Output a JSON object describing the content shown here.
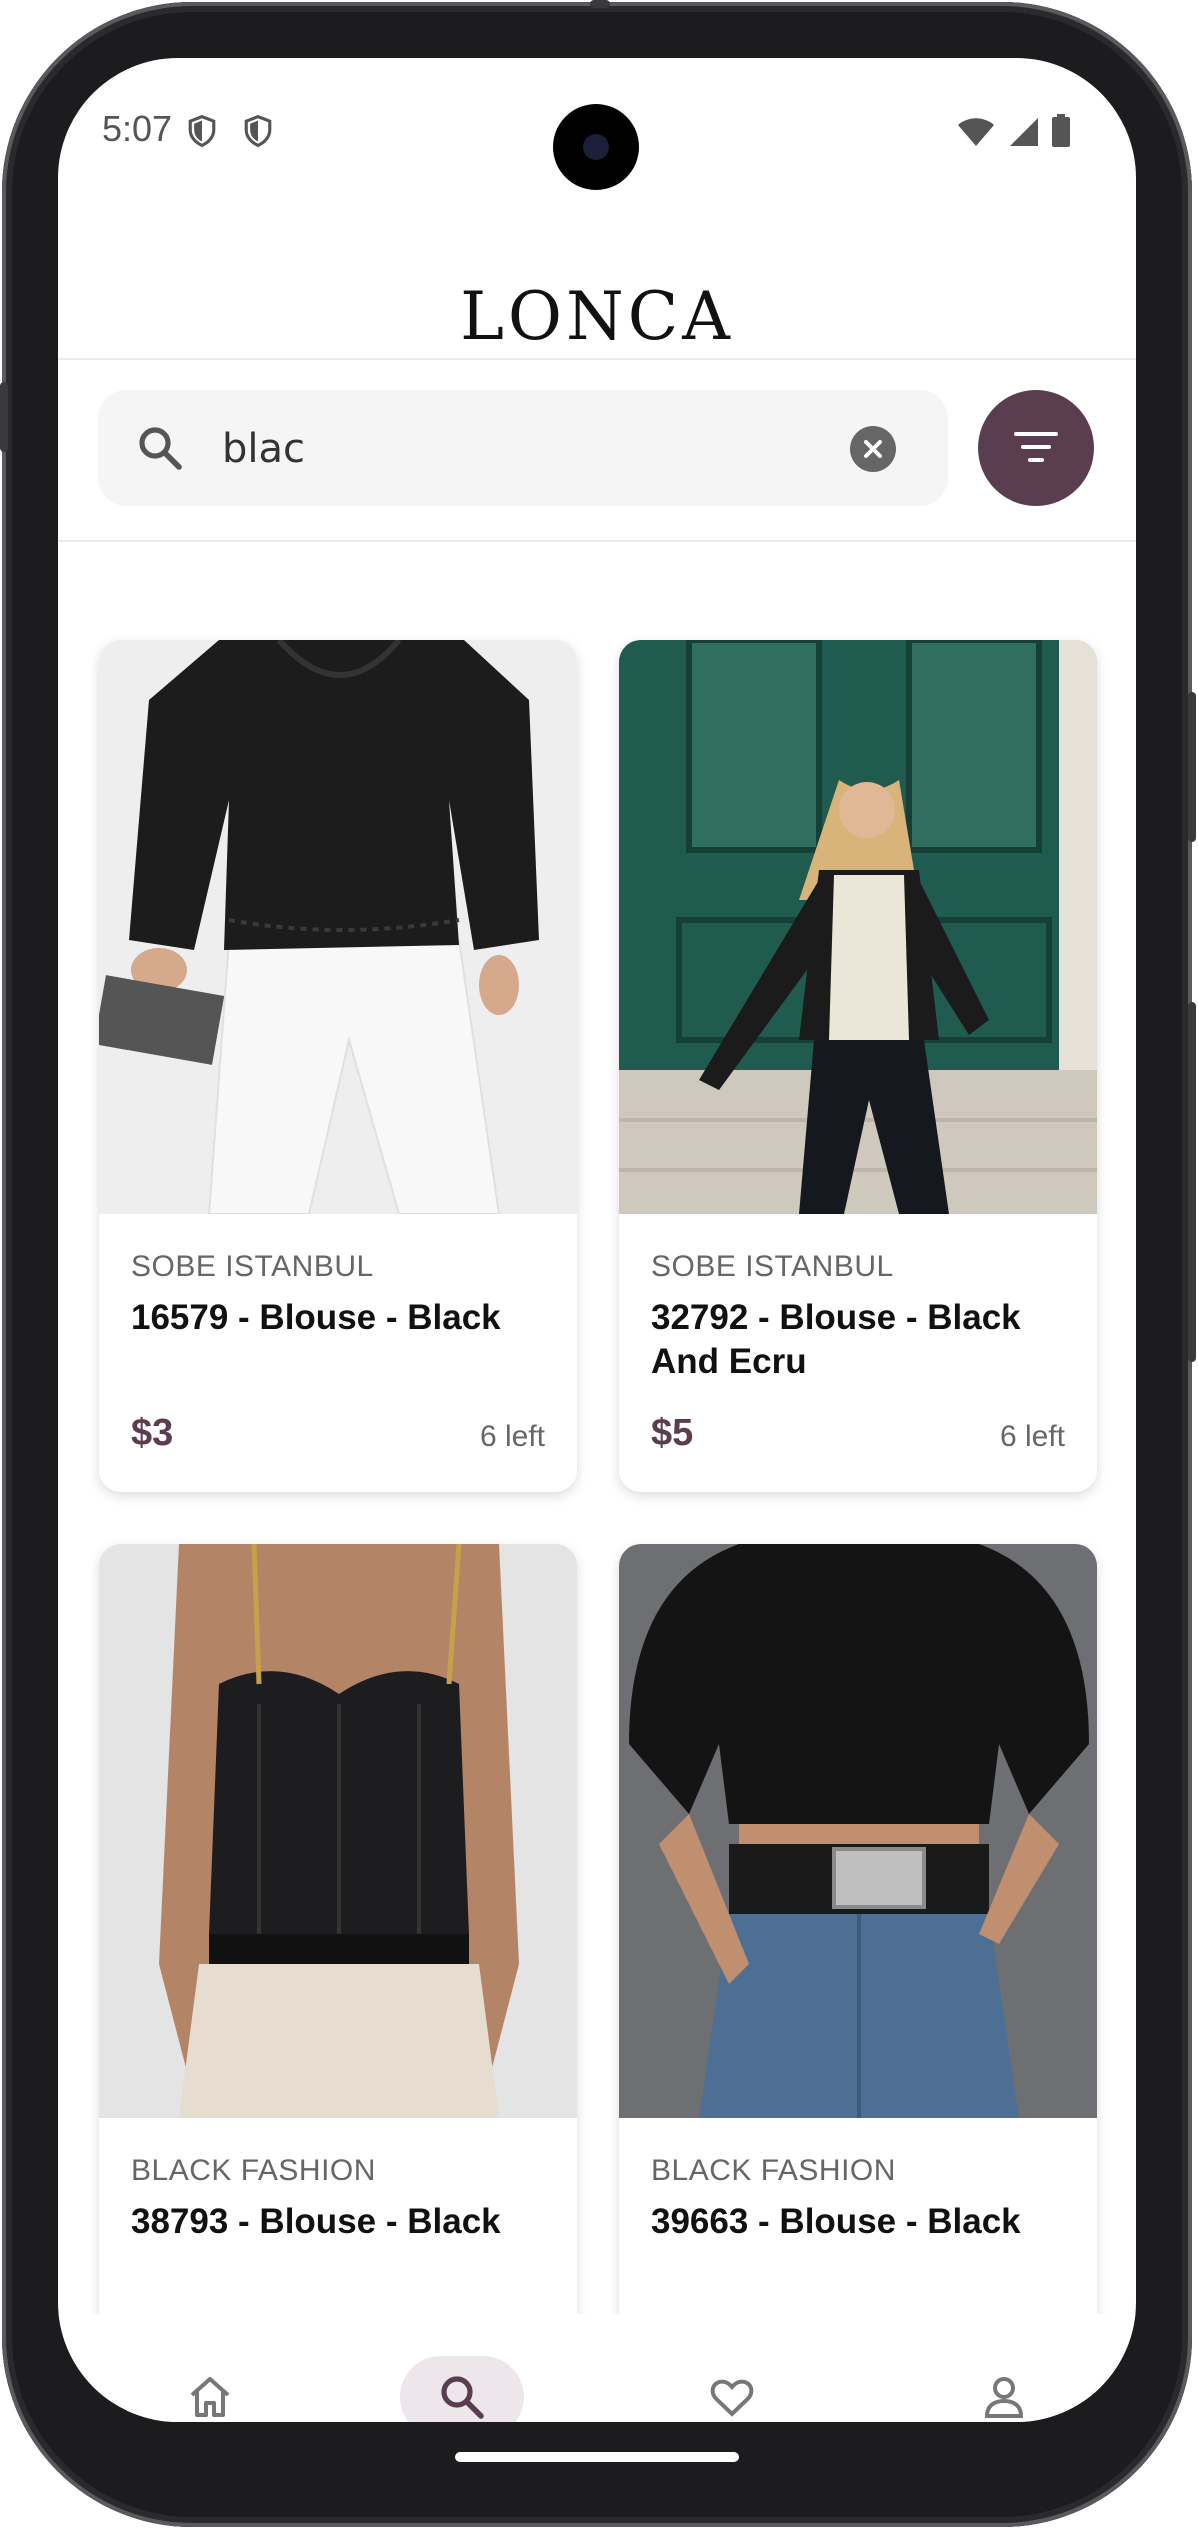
{
  "status_bar": {
    "time": "5:07",
    "icons": [
      "shield-icon",
      "shield-icon",
      "wifi-icon",
      "signal-icon",
      "battery-icon"
    ]
  },
  "header": {
    "logo": "LONCA"
  },
  "search": {
    "value": "blac",
    "icons": [
      "search-icon",
      "clear-icon",
      "filter-icon"
    ]
  },
  "colors": {
    "accent": "#5a3e50",
    "active_nav_bg": "#ede6ea"
  },
  "products": [
    {
      "brand": "SOBE ISTANBUL",
      "title": "16579 - Blouse - Black",
      "price": "$3",
      "stock": "6 left"
    },
    {
      "brand": "SOBE ISTANBUL",
      "title": "32792 - Blouse - Black And Ecru",
      "price": "$5",
      "stock": "6 left"
    },
    {
      "brand": "BLACK FASHION",
      "title": "38793 - Blouse - Black",
      "price": "",
      "stock": ""
    },
    {
      "brand": "BLACK FASHION",
      "title": "39663 - Blouse - Black",
      "price": "",
      "stock": ""
    }
  ],
  "bottom_nav": {
    "items": [
      "home-icon",
      "search-icon",
      "heart-icon",
      "profile-icon"
    ],
    "active": "search-icon"
  }
}
